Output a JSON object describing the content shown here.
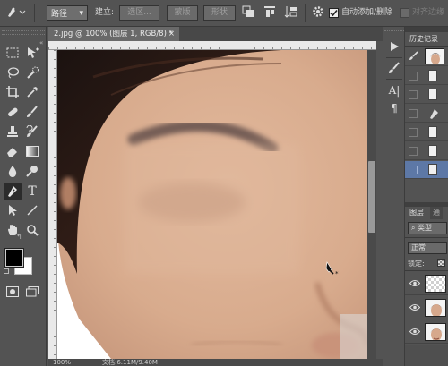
{
  "options_bar": {
    "mode_dropdown": "路径",
    "make_label": "建立:",
    "selection_button": "选区...",
    "mask_button": "蒙版",
    "shape_button": "形状",
    "auto_add_delete_label": "自动添加/删除",
    "auto_add_delete_checked": true,
    "align_edges_label": "对齐边缘",
    "align_edges_checked": false
  },
  "document": {
    "tab_title": "2.jpg @ 100% (图层 1, RGB/8) *",
    "close_glyph": "×"
  },
  "status_bar": {
    "zoom": "100%",
    "doc_info": "文档:6.11M/9.40M"
  },
  "panels": {
    "history_tab": "历史记录",
    "layers_tab": "图层",
    "channels_tab": "通",
    "filter_kind": "类型",
    "blend_mode": "正常",
    "lock_label": "锁定:"
  },
  "colors": {
    "accent_selected": "#5d78a6",
    "foreground_swatch": "#000000",
    "background_swatch": "#ffffff",
    "ui_panel": "#535353"
  },
  "icons": [
    "pen-tool-icon",
    "path-operations-icon",
    "path-alignment-icon",
    "path-arrangement-icon",
    "gear-icon",
    "move-tool-icon",
    "marquee-tool-icon",
    "lasso-tool-icon",
    "quick-selection-icon",
    "crop-tool-icon",
    "eyedropper-icon",
    "healing-brush-icon",
    "brush-tool-icon",
    "clone-stamp-icon",
    "history-brush-icon",
    "eraser-icon",
    "gradient-icon",
    "blur-icon",
    "dodge-icon",
    "pen-tool-icon",
    "type-tool-icon",
    "path-selection-icon",
    "line-tool-icon",
    "hand-tool-icon",
    "zoom-tool-icon",
    "quick-mask-icon",
    "screen-mode-icon",
    "play-icon",
    "brush-presets-icon",
    "character-icon",
    "paragraph-icon",
    "eye-icon"
  ]
}
